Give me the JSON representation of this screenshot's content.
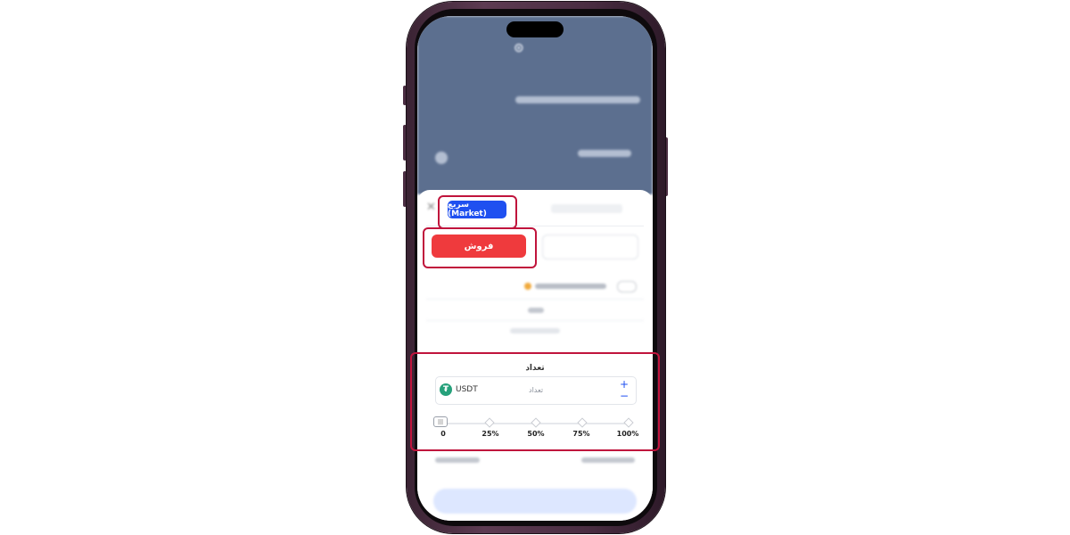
{
  "order_type_tabs": {
    "market_label": "سریع (Market)"
  },
  "side_buttons": {
    "sell_label": "فروش"
  },
  "quantity": {
    "title": "تعداد",
    "placeholder": "تعداد",
    "currency": "USDT",
    "plus": "+",
    "minus": "−"
  },
  "slider": {
    "value_percent": 0,
    "ticks": [
      "0",
      "25%",
      "50%",
      "75%",
      "100%"
    ]
  },
  "colors": {
    "sell": "#ef3a3d",
    "market_tab": "#1f50f0",
    "highlight": "#c0143c",
    "tether": "#26a17b"
  }
}
